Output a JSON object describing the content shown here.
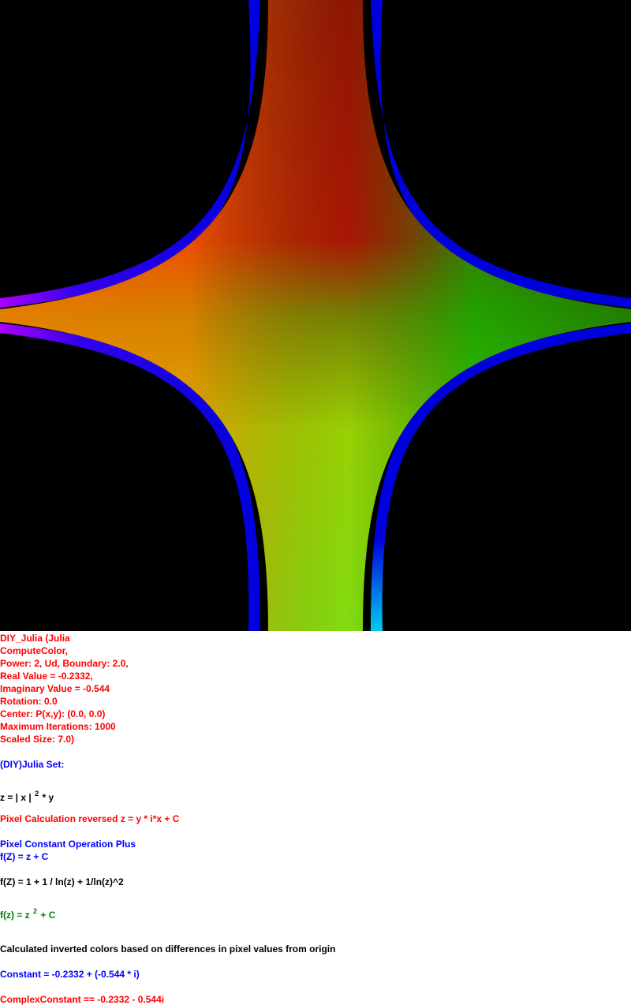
{
  "fractal": {
    "colors": {
      "background": "#000000",
      "band": "#0000ff"
    }
  },
  "params": {
    "line1": "DIY_Julia (Julia",
    "line2": "ComputeColor,",
    "line3": "Power: 2, Ud, Boundary: 2.0,",
    "line4": "Real Value = -0.2332,",
    "line5": "Imaginary Value = -0.544",
    "line6": "Rotation: 0.0",
    "line7": "Center: P(x,y): (0.0, 0.0)",
    "line8": "Maximum Iterations: 1000",
    "line9": "Scaled Size: 7.0)"
  },
  "formula": {
    "set_title": "(DIY)Julia Set:",
    "z_prefix": "z = | x |",
    "z_exp": "2",
    "z_suffix": "* y",
    "pixel_calc": "Pixel Calculation reversed z = y * i*x + C",
    "const_op": "Pixel Constant Operation Plus",
    "fz_plus": "f(Z) = z + C",
    "fz_ln": "f(Z) = 1 + 1 / ln(z) + 1/ln(z)^2",
    "fz_prefix": "f(z) = z",
    "fz_exp": "2",
    "fz_suffix": "+ C",
    "colors_note": "Calculated inverted colors based on differences in pixel values from origin",
    "constant": "Constant = -0.2332 + (-0.544 * i)",
    "complex_constant": "ComplexConstant == -0.2332 - 0.544i"
  }
}
